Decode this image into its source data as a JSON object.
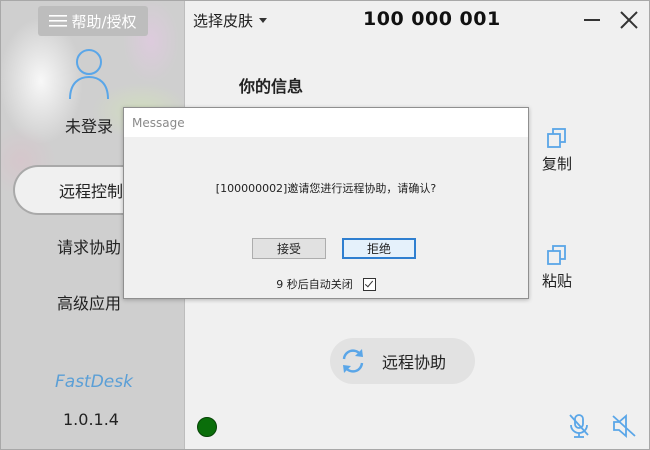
{
  "sidebar": {
    "help_label": "帮助/授权",
    "login_status": "未登录",
    "nav": [
      {
        "label": "远程控制",
        "active": true
      },
      {
        "label": "请求协助",
        "active": false
      },
      {
        "label": "高级应用",
        "active": false
      }
    ],
    "brand": "FastDesk",
    "version": "1.0.1.4"
  },
  "topbar": {
    "skin_label": "选择皮肤",
    "device_id": "100 000 001"
  },
  "main": {
    "title": "你的信息",
    "copy_label": "复制",
    "paste_label": "粘贴",
    "assist_label": "远程协助",
    "status_color": "#0a6e0a"
  },
  "dialog": {
    "title": "Message",
    "message": "[100000002]邀请您进行远程协助，请确认?",
    "accept_label": "接受",
    "reject_label": "拒绝",
    "auto_close_text": "9 秒后自动关闭",
    "auto_close_checked": true
  },
  "icons": [
    "menu-icon",
    "user-icon",
    "copy-icon",
    "paste-icon",
    "refresh-icon",
    "minimize-icon",
    "close-icon",
    "mic-icon",
    "speaker-muted-icon",
    "caret-down-icon"
  ]
}
